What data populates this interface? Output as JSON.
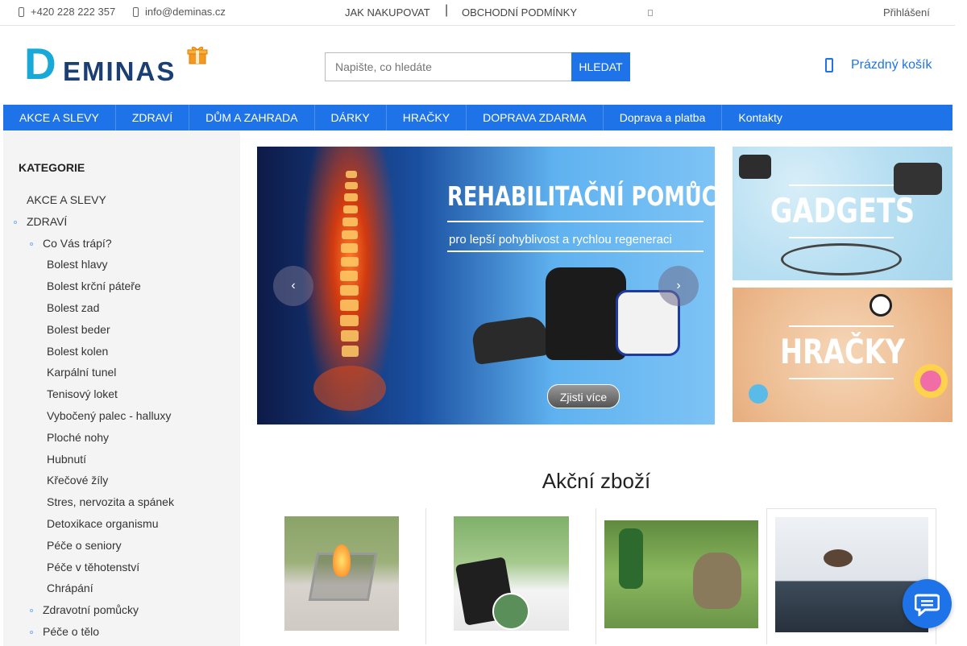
{
  "topbar": {
    "phone": "+420 228 222 357",
    "email": "info@deminas.cz",
    "links": [
      "JAK NAKUPOVAT",
      "OBCHODNÍ PODMÍNKY"
    ],
    "separator": "|",
    "login": "Přihlášení"
  },
  "header": {
    "logo_d": "D",
    "logo_rest": "EMINAS",
    "search_placeholder": "Napište, co hledáte",
    "search_button": "HLEDAT",
    "cart_label": "Prázdný košík"
  },
  "nav": {
    "items": [
      "AKCE A SLEVY",
      "ZDRAVÍ",
      "DŮM A ZAHRADA",
      "DÁRKY",
      "HRAČKY",
      "DOPRAVA ZDARMA",
      "Doprava a platba",
      "Kontakty"
    ]
  },
  "sidebar": {
    "title": "KATEGORIE",
    "items": [
      {
        "label": "AKCE A SLEVY",
        "level": 0,
        "bullet": false
      },
      {
        "label": "ZDRAVÍ",
        "level": 0,
        "bullet": true
      },
      {
        "label": "Co Vás trápí?",
        "level": 1,
        "bullet": true
      },
      {
        "label": "Bolest hlavy",
        "level": 2,
        "bullet": false
      },
      {
        "label": "Bolest krční páteře",
        "level": 2,
        "bullet": false
      },
      {
        "label": "Bolest zad",
        "level": 2,
        "bullet": false
      },
      {
        "label": "Bolest beder",
        "level": 2,
        "bullet": false
      },
      {
        "label": "Bolest kolen",
        "level": 2,
        "bullet": false
      },
      {
        "label": "Karpální tunel",
        "level": 2,
        "bullet": false
      },
      {
        "label": "Tenisový loket",
        "level": 2,
        "bullet": false
      },
      {
        "label": "Vybočený palec - halluxy",
        "level": 2,
        "bullet": false
      },
      {
        "label": "Ploché nohy",
        "level": 2,
        "bullet": false
      },
      {
        "label": "Hubnutí",
        "level": 2,
        "bullet": false
      },
      {
        "label": "Křečové žíly",
        "level": 2,
        "bullet": false
      },
      {
        "label": "Stres, nervozita a spánek",
        "level": 2,
        "bullet": false
      },
      {
        "label": "Detoxikace organismu",
        "level": 2,
        "bullet": false
      },
      {
        "label": "Péče o seniory",
        "level": 2,
        "bullet": false
      },
      {
        "label": "Péče v těhotenství",
        "level": 2,
        "bullet": false
      },
      {
        "label": "Chrápání",
        "level": 2,
        "bullet": false
      },
      {
        "label": "Zdravotní pomůcky",
        "level": 1,
        "bullet": true
      },
      {
        "label": "Péče o tělo",
        "level": 1,
        "bullet": true
      }
    ]
  },
  "slider": {
    "title": "REHABILITAČNÍ POMŮCKY",
    "subtitle": "pro lepší pohyblivost a rychlou regeneraci",
    "button": "Zjisti více",
    "prev_icon": "chevron-left-icon",
    "next_icon": "chevron-right-icon"
  },
  "tiles": [
    {
      "label": "GADGETS"
    },
    {
      "label": "HRAČKY"
    }
  ],
  "section": {
    "title": "Akční zboží"
  },
  "colors": {
    "accent": "#1e73e8",
    "logo_cyan": "#18a9d8",
    "logo_navy": "#1c3f73",
    "sidebar_bg": "#f4f4f4"
  }
}
